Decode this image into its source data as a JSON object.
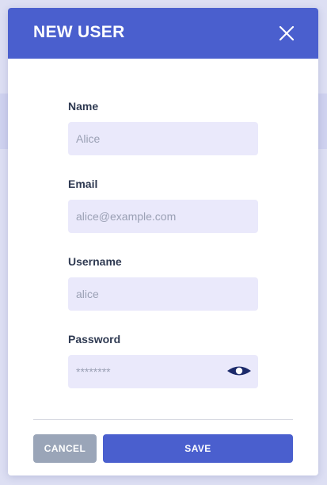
{
  "dialog": {
    "title": "NEW USER",
    "close_icon": "close-icon"
  },
  "form": {
    "name": {
      "label": "Name",
      "placeholder": "Alice"
    },
    "email": {
      "label": "Email",
      "placeholder": "alice@example.com"
    },
    "username": {
      "label": "Username",
      "placeholder": "alice"
    },
    "password": {
      "label": "Password",
      "placeholder": "********",
      "toggle_icon": "eye-icon"
    }
  },
  "actions": {
    "cancel_label": "CANCEL",
    "save_label": "SAVE"
  },
  "colors": {
    "header": "#4a5fce",
    "save_button": "#4a5fce",
    "cancel_button": "#9aa5b8",
    "input_background": "#eae9fb",
    "label_text": "#2f3a52",
    "backdrop": "#dddff3"
  }
}
